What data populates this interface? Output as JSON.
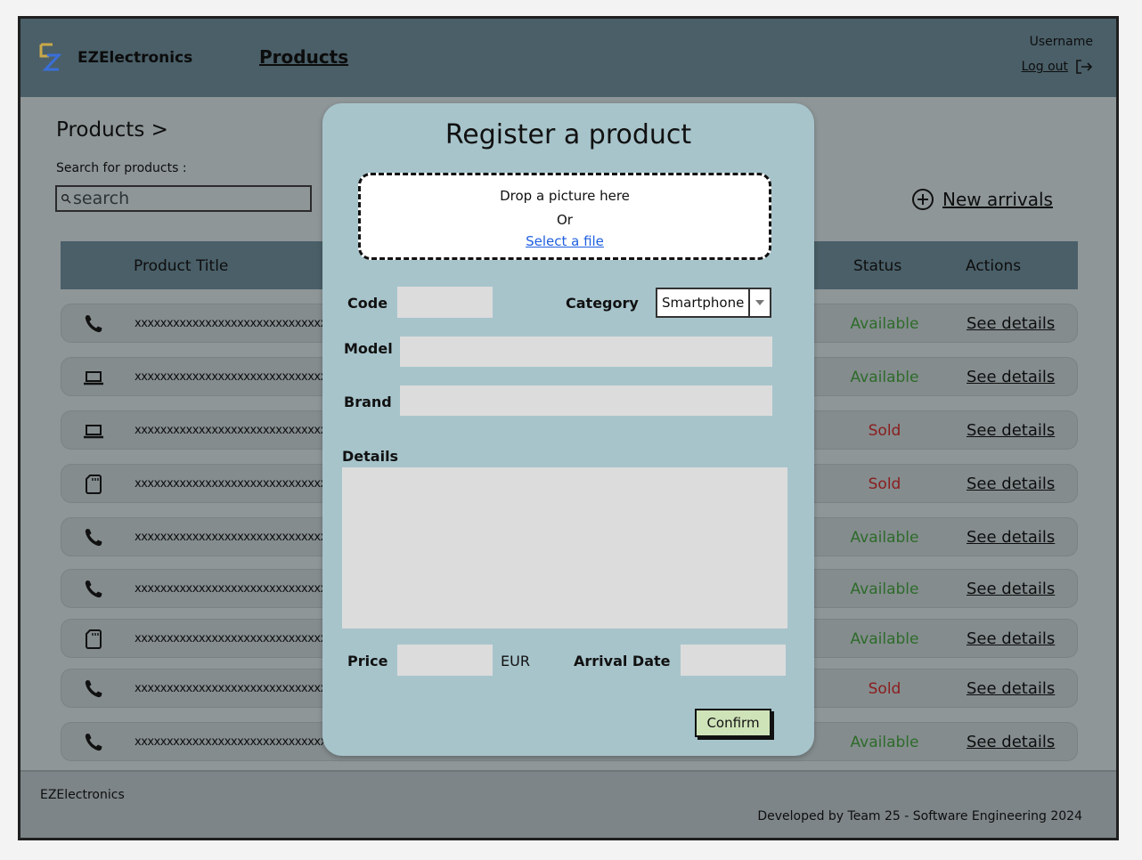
{
  "app": {
    "brand": "EZElectronics",
    "nav_products": "Products",
    "username": "Username",
    "logout": "Log out"
  },
  "page": {
    "breadcrumb": "Products >",
    "search_label": "Search for products :",
    "search_placeholder": "search",
    "new_arrivals": "New arrivals"
  },
  "table": {
    "headers": {
      "title": "Product Title",
      "status": "Status",
      "actions": "Actions"
    },
    "rows": [
      {
        "icon": "phone-icon",
        "title": "xxxxxxxxxxxxxxxxxxxxxxxxxxxxxxxxxx",
        "status": "Available",
        "action": "See details"
      },
      {
        "icon": "laptop-icon",
        "title": "xxxxxxxxxxxxxxxxxxxxxxxxxxxxxxxxxx",
        "status": "Available",
        "action": "See details"
      },
      {
        "icon": "laptop-icon",
        "title": "xxxxxxxxxxxxxxxxxxxxxxxxxxxxxxxxxx",
        "status": "Sold",
        "action": "See details"
      },
      {
        "icon": "memory-card-icon",
        "title": "xxxxxxxxxxxxxxxxxxxxxxxxxxxxxxxxxx",
        "status": "Sold",
        "action": "See details"
      },
      {
        "icon": "phone-icon",
        "title": "xxxxxxxxxxxxxxxxxxxxxxxxxxxxxxxxxx",
        "status": "Available",
        "action": "See details"
      },
      {
        "icon": "phone-icon",
        "title": "xxxxxxxxxxxxxxxxxxxxxxxxxxxxxxxxxx",
        "status": "Available",
        "action": "See details"
      },
      {
        "icon": "memory-card-icon",
        "title": "xxxxxxxxxxxxxxxxxxxxxxxxxxxxxxxxxx",
        "status": "Available",
        "action": "See details"
      },
      {
        "icon": "phone-icon",
        "title": "xxxxxxxxxxxxxxxxxxxxxxxxxxxxxxxxxx",
        "status": "Sold",
        "action": "See details"
      },
      {
        "icon": "phone-icon",
        "title": "xxxxxxxxxxxxxxxxxxxxxxxxxxxxxxxxxx",
        "status": "Available",
        "action": "See details"
      }
    ]
  },
  "modal": {
    "title": "Register a product",
    "drop_text": "Drop a picture here",
    "or_text": "Or",
    "select_file": "Select a file",
    "code_label": "Code",
    "code_value": "",
    "category_label": "Category",
    "category_value": "Smartphone",
    "model_label": "Model",
    "model_value": "",
    "brand_label": "Brand",
    "brand_value": "",
    "details_label": "Details",
    "details_value": "",
    "price_label": "Price",
    "price_value": "",
    "currency": "EUR",
    "arrival_label": "Arrival Date",
    "arrival_value": "",
    "confirm_label": "Confirm"
  },
  "footer": {
    "brand": "EZElectronics",
    "credit": "Developed by Team 25 - Software Engineering 2024"
  },
  "colors": {
    "header_bg": "#4a5f68",
    "modal_bg": "#a7c4cb",
    "available": "#2e6b2a",
    "sold": "#8b1d1d",
    "link": "#1f5fe0",
    "confirm_bg": "#cfe3b8"
  }
}
